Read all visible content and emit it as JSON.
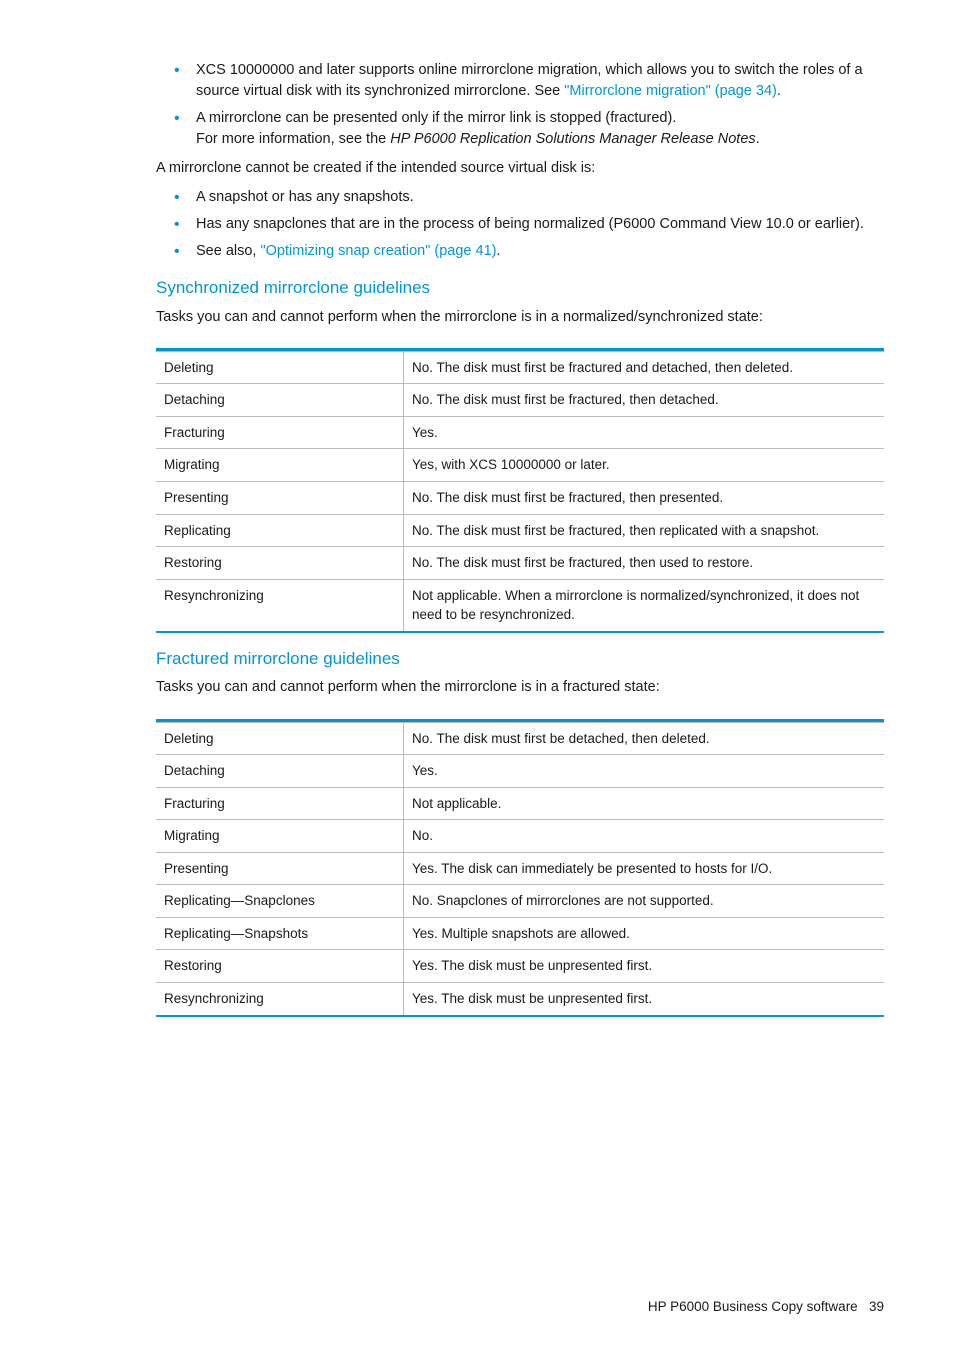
{
  "list1": [
    {
      "text_before": "XCS 10000000 and later supports online mirrorclone migration, which allows you to switch the roles of a source virtual disk with its synchronized mirrorclone. See ",
      "link": "\"Mirrorclone migration\" (page 34)",
      "text_after": "."
    },
    {
      "line1": "A mirrorclone can be presented only if the mirror link is stopped (fractured).",
      "line2_before": "For more information, see the ",
      "line2_italic": "HP P6000 Replication Solutions Manager Release Notes",
      "line2_after": "."
    }
  ],
  "para1": "A mirrorclone cannot be created if the intended source virtual disk is:",
  "list2": [
    {
      "text": "A snapshot or has any snapshots."
    },
    {
      "text": "Has any snapclones that are in the process of being normalized (P6000 Command View 10.0 or earlier)."
    },
    {
      "text_before": "See also, ",
      "link": "\"Optimizing snap creation\" (page 41)",
      "text_after": "."
    }
  ],
  "section1": {
    "heading": "Synchronized mirrorclone guidelines",
    "intro": "Tasks you can and cannot perform when the mirrorclone is in a normalized/synchronized state:",
    "rows": [
      [
        "Deleting",
        "No. The disk must first be fractured and detached, then deleted."
      ],
      [
        "Detaching",
        "No. The disk must first be fractured, then detached."
      ],
      [
        "Fracturing",
        "Yes."
      ],
      [
        "Migrating",
        "Yes, with XCS 10000000 or later."
      ],
      [
        "Presenting",
        "No. The disk must first be fractured, then presented."
      ],
      [
        "Replicating",
        "No. The disk must first be fractured, then replicated with a snapshot."
      ],
      [
        "Restoring",
        "No. The disk must first be fractured, then used to restore."
      ],
      [
        "Resynchronizing",
        "Not applicable. When a mirrorclone is normalized/synchronized, it does not need to be resynchronized."
      ]
    ]
  },
  "section2": {
    "heading": "Fractured mirrorclone guidelines",
    "intro": "Tasks you can and cannot perform when the mirrorclone is in a fractured state:",
    "rows": [
      [
        "Deleting",
        "No. The disk must first be detached, then deleted."
      ],
      [
        "Detaching",
        "Yes."
      ],
      [
        "Fracturing",
        "Not applicable."
      ],
      [
        "Migrating",
        "No."
      ],
      [
        "Presenting",
        "Yes. The disk can immediately be presented to hosts for I/O."
      ],
      [
        "Replicating—Snapclones",
        "No. Snapclones of mirrorclones are not supported."
      ],
      [
        "Replicating—Snapshots",
        "Yes. Multiple snapshots are allowed."
      ],
      [
        "Restoring",
        "Yes. The disk must be unpresented first."
      ],
      [
        "Resynchronizing",
        "Yes. The disk must be unpresented first."
      ]
    ]
  },
  "footer": {
    "title": "HP P6000 Business Copy software",
    "page": "39"
  }
}
